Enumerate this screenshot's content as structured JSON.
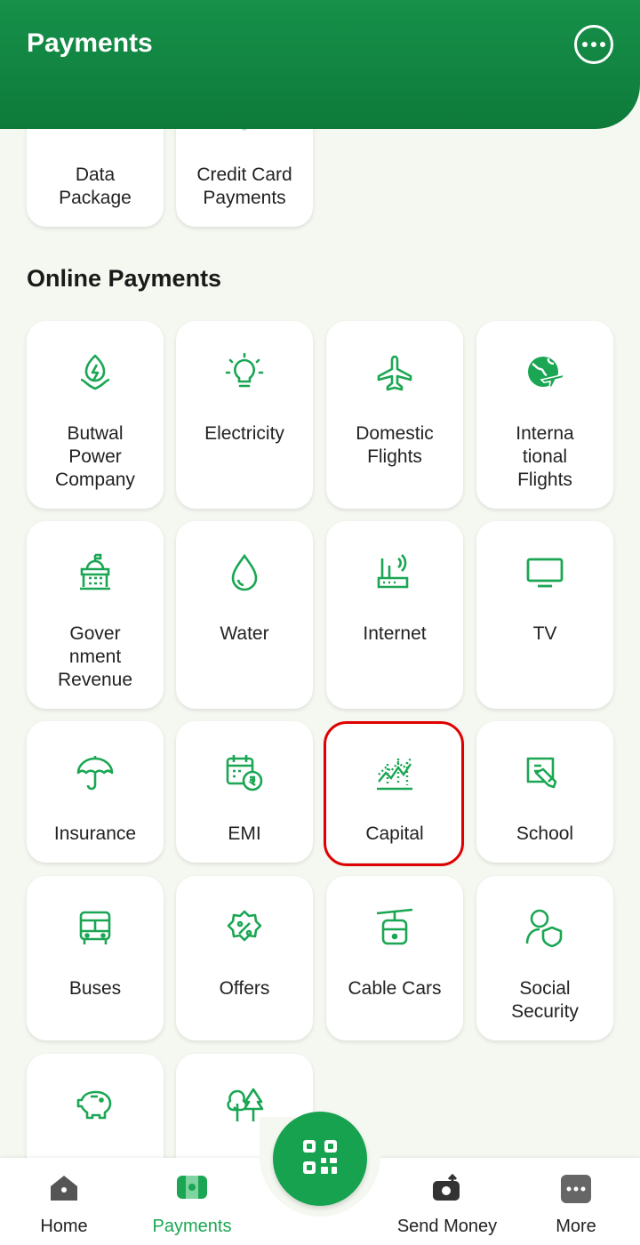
{
  "header": {
    "title": "Payments"
  },
  "top_tiles": [
    {
      "label": "Data\nPackage",
      "icon": "data-package-icon"
    },
    {
      "label": "Credit Card\nPayments",
      "icon": "credit-card-icon"
    }
  ],
  "online_payments": {
    "title": "Online Payments",
    "items": [
      {
        "label": "Butwal\nPower\nCompany",
        "icon": "power-company-icon"
      },
      {
        "label": "Electricity",
        "icon": "bulb-icon"
      },
      {
        "label": "Domestic\nFlights",
        "icon": "airplane-icon"
      },
      {
        "label": "Interna\ntional\nFlights",
        "icon": "globe-plane-icon"
      },
      {
        "label": "Gover\nnment\nRevenue",
        "icon": "government-building-icon"
      },
      {
        "label": "Water",
        "icon": "water-drop-icon"
      },
      {
        "label": "Internet",
        "icon": "router-icon"
      },
      {
        "label": "TV",
        "icon": "tv-icon"
      },
      {
        "label": "Insurance",
        "icon": "umbrella-icon"
      },
      {
        "label": "EMI",
        "icon": "calendar-money-icon"
      },
      {
        "label": "Capital",
        "icon": "stock-chart-icon"
      },
      {
        "label": "School",
        "icon": "book-pencil-icon"
      },
      {
        "label": "Buses",
        "icon": "bus-icon"
      },
      {
        "label": "Offers",
        "icon": "discount-badge-icon"
      },
      {
        "label": "Cable Cars",
        "icon": "cable-car-icon"
      },
      {
        "label": "Social\nSecurity",
        "icon": "person-shield-icon"
      },
      {
        "label": "",
        "icon": "piggy-bank-icon"
      },
      {
        "label": "",
        "icon": "trees-icon"
      }
    ]
  },
  "bottom_nav": [
    {
      "label": "Home",
      "icon": "home-icon"
    },
    {
      "label": "Payments",
      "icon": "payments-icon",
      "active": true
    },
    {
      "label": "Send Money",
      "icon": "send-money-icon"
    },
    {
      "label": "More",
      "icon": "more-icon"
    }
  ],
  "fab": {
    "icon": "qr-scan-icon"
  },
  "colors": {
    "brand": "#17a24f",
    "header": "#0e7a3a",
    "icon": "#1aa653",
    "highlight": "#e00000"
  }
}
